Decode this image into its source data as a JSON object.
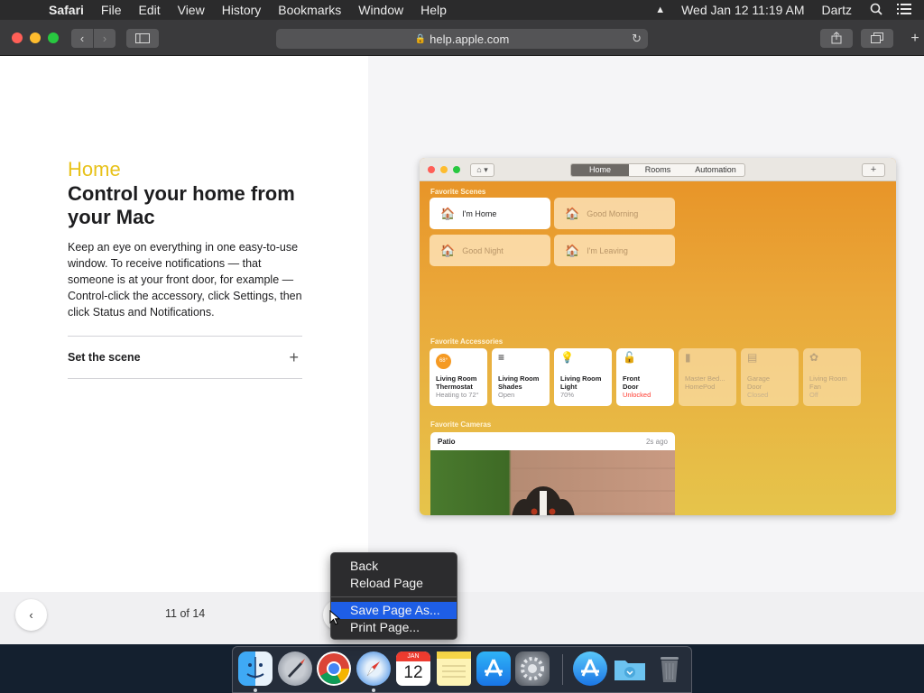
{
  "menubar": {
    "app": "Safari",
    "items": [
      "File",
      "Edit",
      "View",
      "History",
      "Bookmarks",
      "Window",
      "Help"
    ],
    "clock": "Wed Jan 12  11:19 AM",
    "user": "Dartz"
  },
  "browser": {
    "url": "help.apple.com"
  },
  "article": {
    "eyebrow": "Home",
    "headline": "Control your home from your Mac",
    "body": "Keep an eye on everything in one easy-to-use window. To receive notifications — that someone is at your front door, for example — Control-click the accessory, click Settings, then click Status and Notifications.",
    "accordion_label": "Set the scene",
    "accordion_icon": "+"
  },
  "home_app": {
    "tabs": [
      "Home",
      "Rooms",
      "Automation"
    ],
    "active_tab": "Home",
    "add_label": "+",
    "favorite_scenes_label": "Favorite Scenes",
    "scenes": [
      {
        "name": "I'm Home",
        "on": true
      },
      {
        "name": "Good Morning",
        "on": false
      },
      {
        "name": "Good Night",
        "on": false
      },
      {
        "name": "I'm Leaving",
        "on": false
      }
    ],
    "favorite_accessories_label": "Favorite Accessories",
    "accessories": [
      {
        "icon": "68°",
        "line1": "Living Room",
        "line2": "Thermostat",
        "status": "Heating to 72°",
        "on": true
      },
      {
        "icon": "≡",
        "line1": "Living Room",
        "line2": "Shades",
        "status": "Open",
        "on": true
      },
      {
        "icon": "💡",
        "line1": "Living Room",
        "line2": "Light",
        "status": "70%",
        "on": true
      },
      {
        "icon": "🔓",
        "line1": "Front",
        "line2": "Door",
        "status": "Unlocked",
        "on": true
      },
      {
        "icon": "▮",
        "line1": "Master Bed...",
        "line2": "HomePod",
        "status": "",
        "on": false
      },
      {
        "icon": "▤",
        "line1": "Garage",
        "line2": "Door",
        "status": "Closed",
        "on": false
      },
      {
        "icon": "✿",
        "line1": "Living Room",
        "line2": "Fan",
        "status": "Off",
        "on": false
      }
    ],
    "favorite_cameras_label": "Favorite Cameras",
    "camera": {
      "name": "Patio",
      "ago": "2s ago"
    }
  },
  "pagenav": {
    "counter": "11 of 14"
  },
  "context_menu": {
    "items": [
      "Back",
      "Reload Page",
      "Save Page As...",
      "Print Page..."
    ],
    "highlighted": "Save Page As..."
  },
  "dock": {
    "calendar_month": "JAN",
    "calendar_day": "12"
  },
  "colors": {
    "accent_yellow": "#e8c21a",
    "menu_highlight": "#1e5ee6",
    "home_orange": "#e79125"
  }
}
